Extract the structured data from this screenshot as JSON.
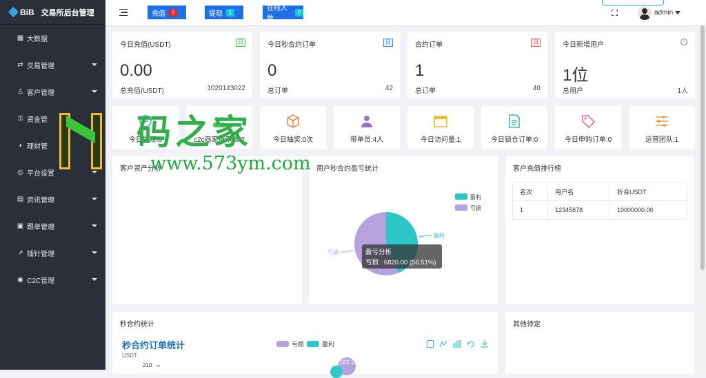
{
  "brand": {
    "logo": "BiB",
    "title": "交易所后台管理"
  },
  "sidebar": {
    "items": [
      {
        "label": "大数据",
        "icon": "chart-icon",
        "arrow": false
      },
      {
        "label": "交易管理",
        "icon": "exchange-icon",
        "arrow": true
      },
      {
        "label": "客户管理",
        "icon": "users-icon",
        "arrow": true
      },
      {
        "label": "资金管",
        "icon": "lock-icon",
        "arrow": true
      },
      {
        "label": "理财管",
        "icon": "piggy-icon",
        "arrow": true
      },
      {
        "label": "平台设置",
        "icon": "settings-icon",
        "arrow": true
      },
      {
        "label": "资讯管理",
        "icon": "news-icon",
        "arrow": true
      },
      {
        "label": "跟单管理",
        "icon": "follow-icon",
        "arrow": true
      },
      {
        "label": "插针管理",
        "icon": "needle-icon",
        "arrow": true
      },
      {
        "label": "C2C管理",
        "icon": "c2c-icon",
        "arrow": true
      }
    ]
  },
  "topbar": {
    "recharge": {
      "label": "充值",
      "count": "3"
    },
    "withdraw": {
      "label": "提现",
      "count": "1"
    },
    "online": {
      "label": "在线人数",
      "count": "0"
    },
    "user": "admin"
  },
  "stats": [
    {
      "title": "今日充值(USDT)",
      "tag": "日",
      "value": "0.00",
      "sub_label": "总充值(USDT)",
      "sub_value": "1020143022"
    },
    {
      "title": "今日秒合约订单",
      "tag": "日",
      "value": "0",
      "sub_label": "总订单",
      "sub_value": "42"
    },
    {
      "title": "合约订单",
      "tag": "日",
      "value": "1",
      "sub_label": "总订单",
      "sub_value": "40"
    },
    {
      "title": "今日新增用户",
      "tag": "",
      "value": "1位",
      "sub_label": "总用户",
      "sub_value": "1人"
    }
  ],
  "quick": [
    {
      "label": "今日提现:0",
      "icon": "wallet-icon",
      "color": "#36b3a8"
    },
    {
      "label": "c2c商家待审核:2",
      "icon": "group-icon",
      "color": "#5fbf5b"
    },
    {
      "label": "今日抽奖:0次",
      "icon": "box-icon",
      "color": "#f08c46"
    },
    {
      "label": "带单员:4人",
      "icon": "person-icon",
      "color": "#9b6fd0"
    },
    {
      "label": "今日访问量:1",
      "icon": "window-icon",
      "color": "#f0b92c"
    },
    {
      "label": "今日锁仓订单:0",
      "icon": "document-icon",
      "color": "#3fb7b8"
    },
    {
      "label": "今日申购订单:0",
      "icon": "price-tag-icon",
      "color": "#ef6a9a"
    },
    {
      "label": "运营团队:1",
      "icon": "sliders-icon",
      "color": "#f0a03c"
    }
  ],
  "panels": {
    "customer_analysis": "客户资产分析",
    "pie_panel": "用户秒合约盈亏统计",
    "ranking": "客户充值排行榜",
    "contract_stats": "秒合约统计",
    "other": "其他待定"
  },
  "ranking_table": {
    "headers": [
      "名次",
      "用户名",
      "折合USDT"
    ],
    "rows": [
      [
        "1",
        "12345678",
        "10000000.00"
      ]
    ]
  },
  "chart_data": {
    "type": "pie",
    "title": "",
    "slices": [
      {
        "name": "盈利",
        "value": 5265,
        "color": "#2ec7c9"
      },
      {
        "name": "亏损",
        "value": 6820,
        "color": "#b6a2de"
      }
    ],
    "legend_position": "top-right",
    "tooltip": {
      "title": "盈亏分析",
      "text": "亏损 : 6820.00 (56.51%)"
    }
  },
  "contract_chart": {
    "title": "秒合约订单统计",
    "unit": "USDT",
    "legend": [
      {
        "name": "亏损",
        "color": "#b6a2de"
      },
      {
        "name": "盈利",
        "color": "#2ec7c9"
      }
    ],
    "y_tick": "210",
    "label": "182.2"
  },
  "watermark": {
    "text1": "码之家",
    "text2": "www.573ym.com"
  }
}
